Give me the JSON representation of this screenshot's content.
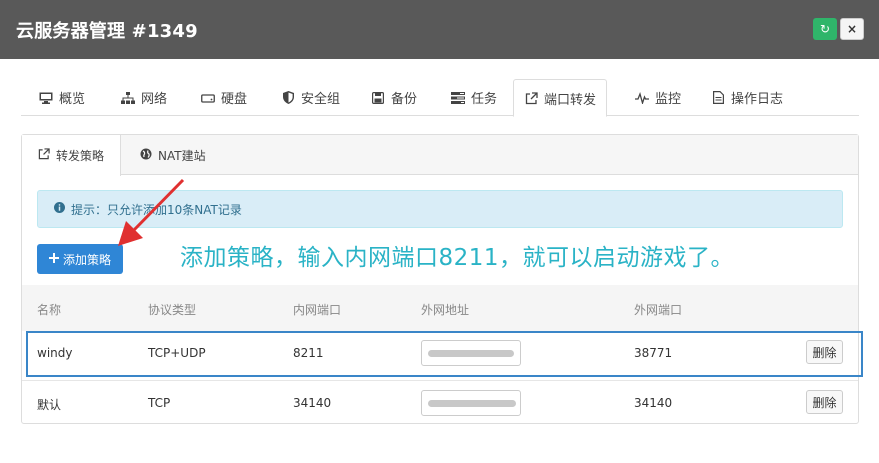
{
  "header": {
    "title": "云服务器管理 #1349",
    "refresh_icon": "refresh-icon",
    "close_icon": "close-icon",
    "close_glyph": "×",
    "refresh_glyph": "↻"
  },
  "main_tabs": [
    {
      "label": "概览",
      "icon": "monitor-icon"
    },
    {
      "label": "网络",
      "icon": "sitemap-icon"
    },
    {
      "label": "硬盘",
      "icon": "hdd-icon"
    },
    {
      "label": "安全组",
      "icon": "shield-icon"
    },
    {
      "label": "备份",
      "icon": "save-icon"
    },
    {
      "label": "任务",
      "icon": "tasks-icon"
    },
    {
      "label": "端口转发",
      "icon": "external-link-icon",
      "active": true
    },
    {
      "label": "监控",
      "icon": "pulse-icon"
    },
    {
      "label": "操作日志",
      "icon": "file-icon"
    }
  ],
  "sub_tabs": [
    {
      "label": "转发策略",
      "icon": "external-link-icon",
      "active": true
    },
    {
      "label": "NAT建站",
      "icon": "globe-icon"
    }
  ],
  "alert": {
    "text": "提示：只允许添加10条NAT记录",
    "icon": "info-circle-icon"
  },
  "add_button": {
    "label": "添加策略",
    "icon": "plus-icon"
  },
  "annotation": "添加策略，输入内网端口8211，就可以启动游戏了。",
  "table": {
    "headers": [
      "名称",
      "协议类型",
      "内网端口",
      "外网地址",
      "外网端口"
    ],
    "rows": [
      {
        "name": "windy",
        "protocol": "TCP+UDP",
        "internal_port": "8211",
        "external_port": "38771",
        "delete_label": "删除"
      },
      {
        "name": "默认",
        "protocol": "TCP",
        "internal_port": "34140",
        "external_port": "34140",
        "delete_label": "删除"
      }
    ]
  },
  "colors": {
    "header_bg": "#595959",
    "primary": "#2f86d6",
    "annotation": "#2ab3c6",
    "arrow": "#e03030",
    "highlight": "#3a86c8",
    "alert_bg": "#d9edf7"
  }
}
